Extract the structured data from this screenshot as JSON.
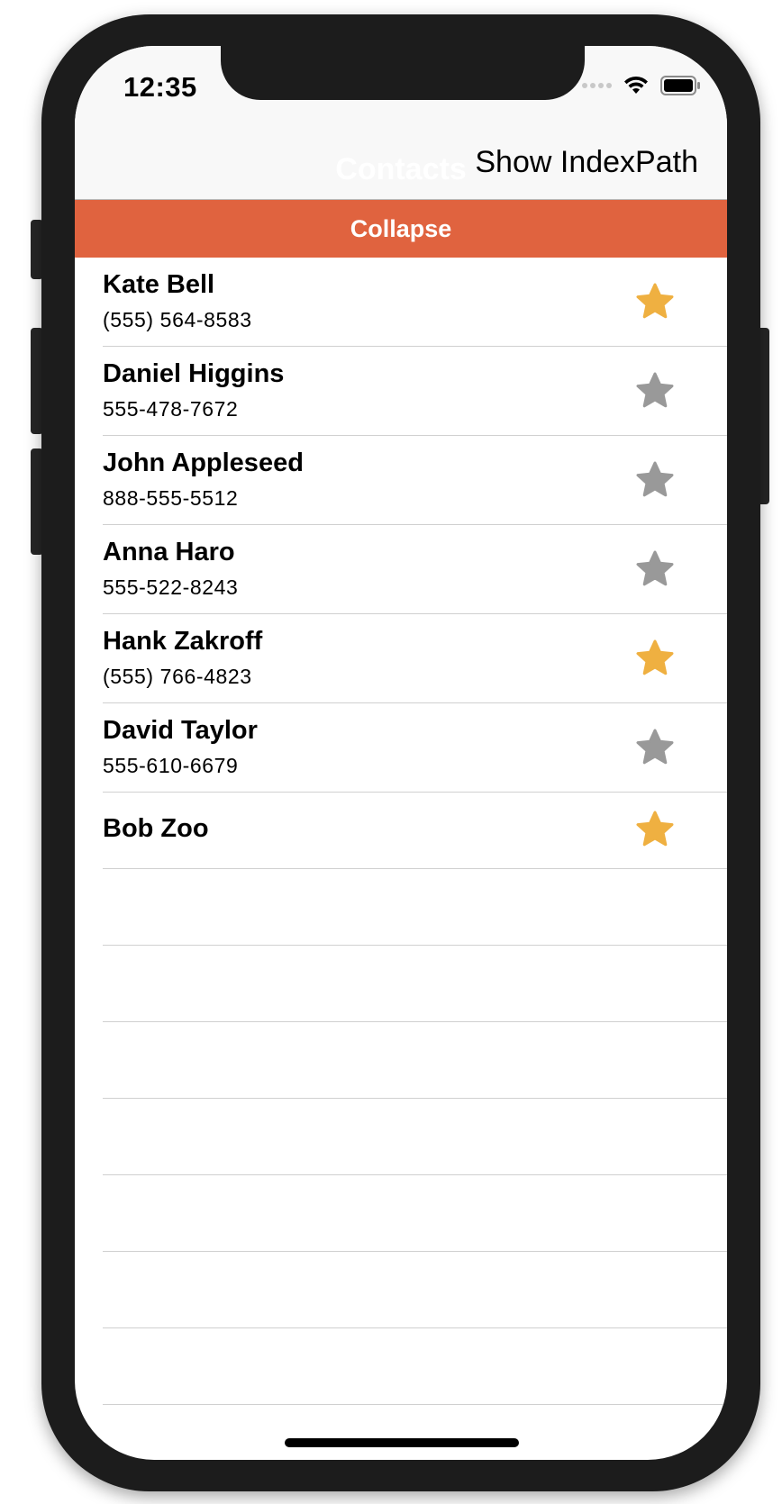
{
  "status_bar": {
    "time": "12:35",
    "signal_icon": "signal-dots-icon",
    "wifi_icon": "wifi-icon",
    "battery_icon": "battery-icon"
  },
  "nav": {
    "title": "Contacts",
    "right_button": "Show IndexPath"
  },
  "collapse_bar": {
    "label": "Collapse",
    "color": "#e0633f"
  },
  "colors": {
    "star_favorite": "#efb041",
    "star_normal": "#999999"
  },
  "contacts": [
    {
      "name": "Kate Bell",
      "phone": "(555) 564-8583",
      "favorite": true
    },
    {
      "name": "Daniel Higgins",
      "phone": "555-478-7672",
      "favorite": false
    },
    {
      "name": "John Appleseed",
      "phone": "888-555-5512",
      "favorite": false
    },
    {
      "name": "Anna Haro",
      "phone": "555-522-8243",
      "favorite": false
    },
    {
      "name": "Hank Zakroff",
      "phone": "(555) 766-4823",
      "favorite": true
    },
    {
      "name": "David Taylor",
      "phone": "555-610-6679",
      "favorite": false
    },
    {
      "name": "Bob Zoo",
      "phone": "",
      "favorite": true
    }
  ]
}
